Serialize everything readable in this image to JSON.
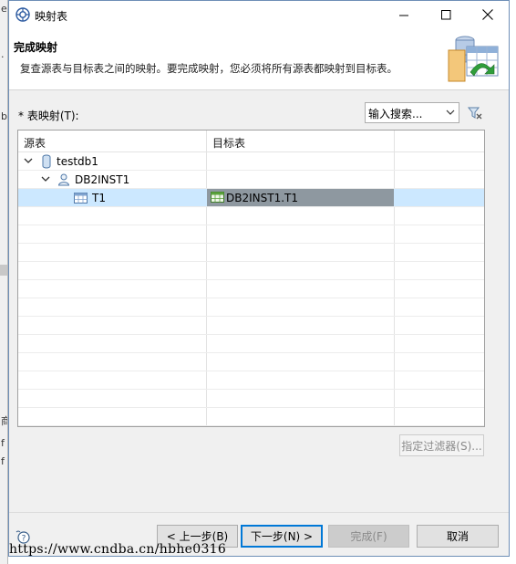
{
  "background_window": {
    "fragments": [
      "er",
      ".",
      "b",
      "商",
      "f",
      "f"
    ]
  },
  "window": {
    "title": "映射表",
    "controls": {
      "minimize": "minimize-icon",
      "maximize": "maximize-icon",
      "close": "close-icon"
    }
  },
  "header": {
    "title": "完成映射",
    "description": "复查源表与目标表之间的映射。要完成映射，您必须将所有源表都映射到目标表。"
  },
  "mapping": {
    "label": "* 表映射(T):",
    "search_value": "输入搜索...",
    "columns": [
      "源表",
      "目标表"
    ],
    "rows": [
      {
        "level": 0,
        "expanded": true,
        "icon": "database-icon",
        "source": "testdb1",
        "target": ""
      },
      {
        "level": 1,
        "expanded": true,
        "icon": "user-icon",
        "source": "DB2INST1",
        "target": ""
      },
      {
        "level": 2,
        "icon": "table-icon",
        "source": "T1",
        "target": "DB2INST1.T1",
        "selected": true
      }
    ],
    "filter_button": "指定过滤器(S)..."
  },
  "footer": {
    "prev_label": "< 上一步(B)",
    "next_label": "下一步(N) >",
    "finish_label": "完成(F)",
    "cancel_label": "取消"
  },
  "watermark": "https://www.cndba.cn/hbhe0316",
  "colors": {
    "selection": "#cce8ff",
    "target_highlight": "#8e98a0",
    "default_button_border": "#0078d7"
  }
}
